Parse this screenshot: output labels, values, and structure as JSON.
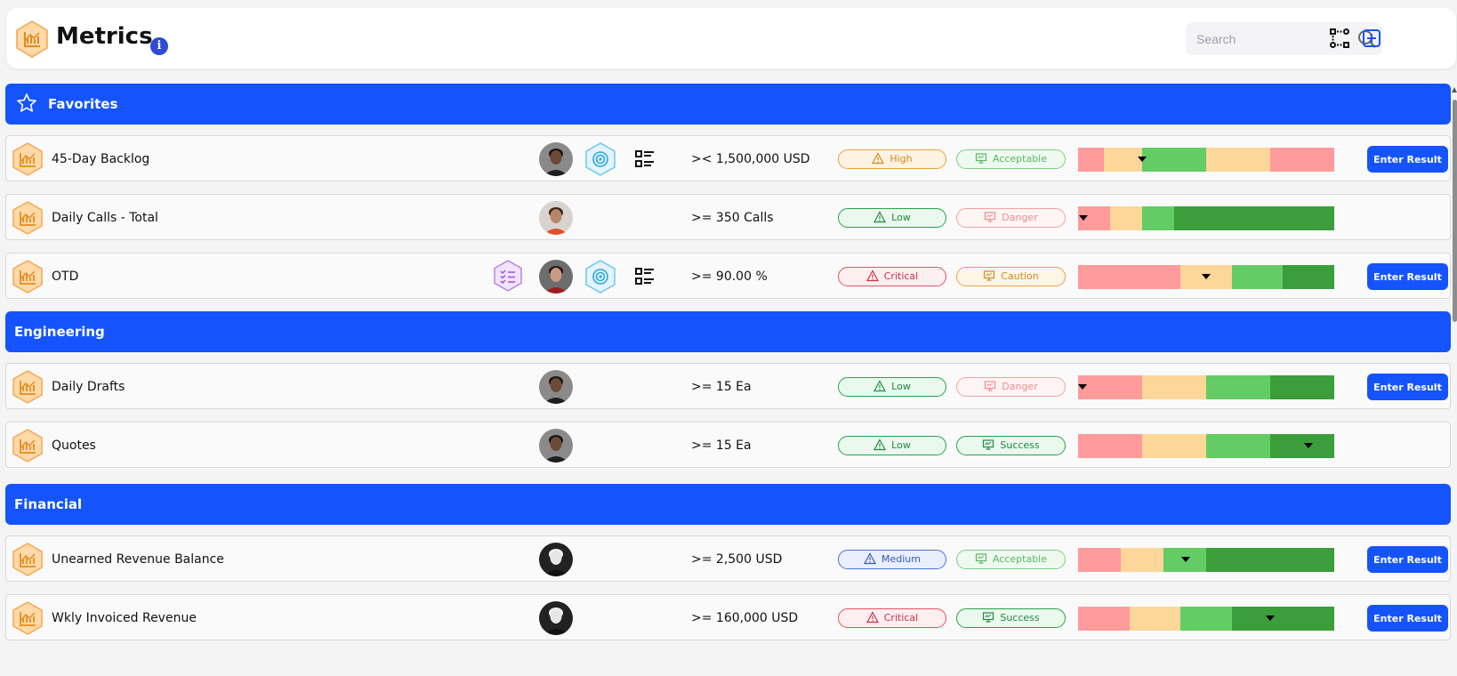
{
  "header": {
    "title": "Metrics",
    "info_glyph": "i",
    "search_placeholder": "Search",
    "icons": [
      "metrics-logo-icon",
      "info-icon",
      "search-icon",
      "flow-icon",
      "add-icon"
    ]
  },
  "colors": {
    "accent": "#1554fc",
    "gauge_red": "#ff9b9b",
    "gauge_yellow": "#fdd699",
    "gauge_light_green": "#64cc64",
    "gauge_dark_green": "#3b9e3b",
    "logo_orange": "#ffc98a"
  },
  "groups": [
    {
      "label": "Favorites",
      "has_star": true,
      "rows": [
        {
          "name": "45-Day Backlog",
          "goal": ">< 1,500,000 USD",
          "avatar": "man-dark",
          "has_target": true,
          "has_details": true,
          "has_checklist": false,
          "priority": "High",
          "status": "Acceptable",
          "button": "Enter Result",
          "gauge": {
            "segments": [
              {
                "color": "red",
                "share": 0.1
              },
              {
                "color": "yellow",
                "share": 0.15
              },
              {
                "color": "light_green",
                "share": 0.25
              },
              {
                "color": "yellow",
                "share": 0.25
              },
              {
                "color": "red",
                "share": 0.25
              }
            ],
            "marker": 0.25
          }
        },
        {
          "name": "Daily Calls - Total",
          "goal": ">= 350 Calls",
          "avatar": "woman-brown",
          "has_target": false,
          "has_details": false,
          "has_checklist": false,
          "priority": "Low",
          "status": "Danger",
          "button": "",
          "gauge": {
            "segments": [
              {
                "color": "red",
                "share": 0.125
              },
              {
                "color": "yellow",
                "share": 0.125
              },
              {
                "color": "light_green",
                "share": 0.125
              },
              {
                "color": "dark_green",
                "share": 0.625
              }
            ],
            "marker": 0.02
          }
        },
        {
          "name": "OTD",
          "goal": ">= 90.00 %",
          "avatar": "woman-red",
          "has_target": true,
          "has_details": true,
          "has_checklist": true,
          "priority": "Critical",
          "status": "Caution",
          "button": "Enter Result",
          "gauge": {
            "segments": [
              {
                "color": "red",
                "share": 0.4
              },
              {
                "color": "yellow",
                "share": 0.2
              },
              {
                "color": "light_green",
                "share": 0.2
              },
              {
                "color": "dark_green",
                "share": 0.2
              }
            ],
            "marker": 0.5
          }
        }
      ]
    },
    {
      "label": "Engineering",
      "has_star": false,
      "rows": [
        {
          "name": "Daily Drafts",
          "goal": ">= 15 Ea",
          "avatar": "man-dark",
          "has_target": false,
          "has_details": false,
          "has_checklist": false,
          "priority": "Low",
          "status": "Danger",
          "button": "Enter Result",
          "gauge": {
            "segments": [
              {
                "color": "red",
                "share": 0.25
              },
              {
                "color": "yellow",
                "share": 0.25
              },
              {
                "color": "light_green",
                "share": 0.25
              },
              {
                "color": "dark_green",
                "share": 0.25
              }
            ],
            "marker": 0.0
          }
        },
        {
          "name": "Quotes",
          "goal": ">= 15 Ea",
          "avatar": "man-dark",
          "has_target": false,
          "has_details": false,
          "has_checklist": false,
          "priority": "Low",
          "status": "Success",
          "button": "",
          "gauge": {
            "segments": [
              {
                "color": "red",
                "share": 0.25
              },
              {
                "color": "yellow",
                "share": 0.25
              },
              {
                "color": "light_green",
                "share": 0.25
              },
              {
                "color": "dark_green",
                "share": 0.25
              }
            ],
            "marker": 0.9
          }
        }
      ]
    },
    {
      "label": "Financial",
      "has_star": false,
      "rows": [
        {
          "name": "Unearned Revenue Balance",
          "goal": ">= 2,500 USD",
          "avatar": "man-bald",
          "has_target": false,
          "has_details": false,
          "has_checklist": false,
          "priority": "Medium",
          "status": "Acceptable",
          "button": "Enter Result",
          "gauge": {
            "segments": [
              {
                "color": "red",
                "share": 0.167
              },
              {
                "color": "yellow",
                "share": 0.167
              },
              {
                "color": "light_green",
                "share": 0.167
              },
              {
                "color": "dark_green",
                "share": 0.5
              }
            ],
            "marker": 0.42
          }
        },
        {
          "name": "Wkly Invoiced Revenue",
          "goal": ">= 160,000 USD",
          "avatar": "man-bald",
          "has_target": false,
          "has_details": false,
          "has_checklist": false,
          "priority": "Critical",
          "status": "Success",
          "button": "Enter Result",
          "gauge": {
            "segments": [
              {
                "color": "red",
                "share": 0.2
              },
              {
                "color": "yellow",
                "share": 0.2
              },
              {
                "color": "light_green",
                "share": 0.2
              },
              {
                "color": "dark_green",
                "share": 0.4
              }
            ],
            "marker": 0.75
          }
        }
      ]
    }
  ]
}
